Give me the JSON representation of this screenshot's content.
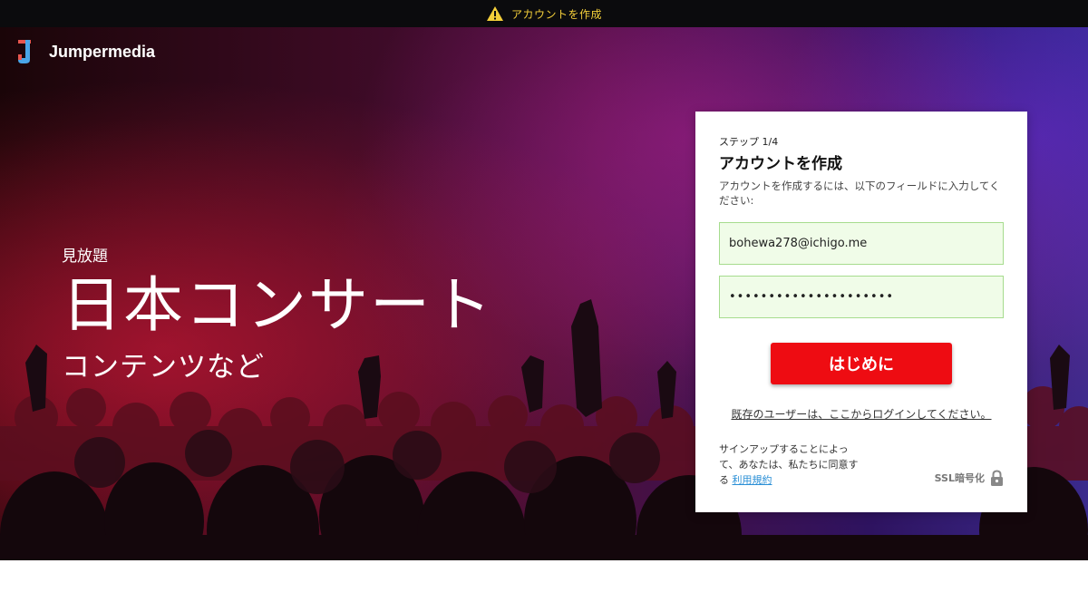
{
  "topbar": {
    "icon": "warning-icon",
    "notice": "アカウントを作成",
    "notice_color": "#f4cf3a"
  },
  "brand": {
    "name": "Jumpermedia",
    "logo_icon": "jumpermedia-logo-icon"
  },
  "hero": {
    "eyebrow": "見放題",
    "headline": "日本コンサート",
    "sub": "コンテンツなど"
  },
  "card": {
    "step": "ステップ 1/4",
    "title": "アカウントを作成",
    "description": "アカウントを作成するには、以下のフィールドに入力してください:",
    "email_value": "bohewa278@ichigo.me",
    "password_value": "•••••••••••••••••••••",
    "cta_label": "はじめに",
    "login_link": "既存のユーザーは、ここからログインしてください。",
    "terms_prefix": "サインアップすることによって、あなたは、私たちに同意する",
    "terms_link": "利用規約",
    "ssl_label": "SSL暗号化",
    "ssl_icon": "lock-icon"
  },
  "colors": {
    "cta": "#ee0c12",
    "field_bg": "#f0fce8",
    "field_border": "#a6dc8e",
    "link": "#2a8fd6"
  }
}
